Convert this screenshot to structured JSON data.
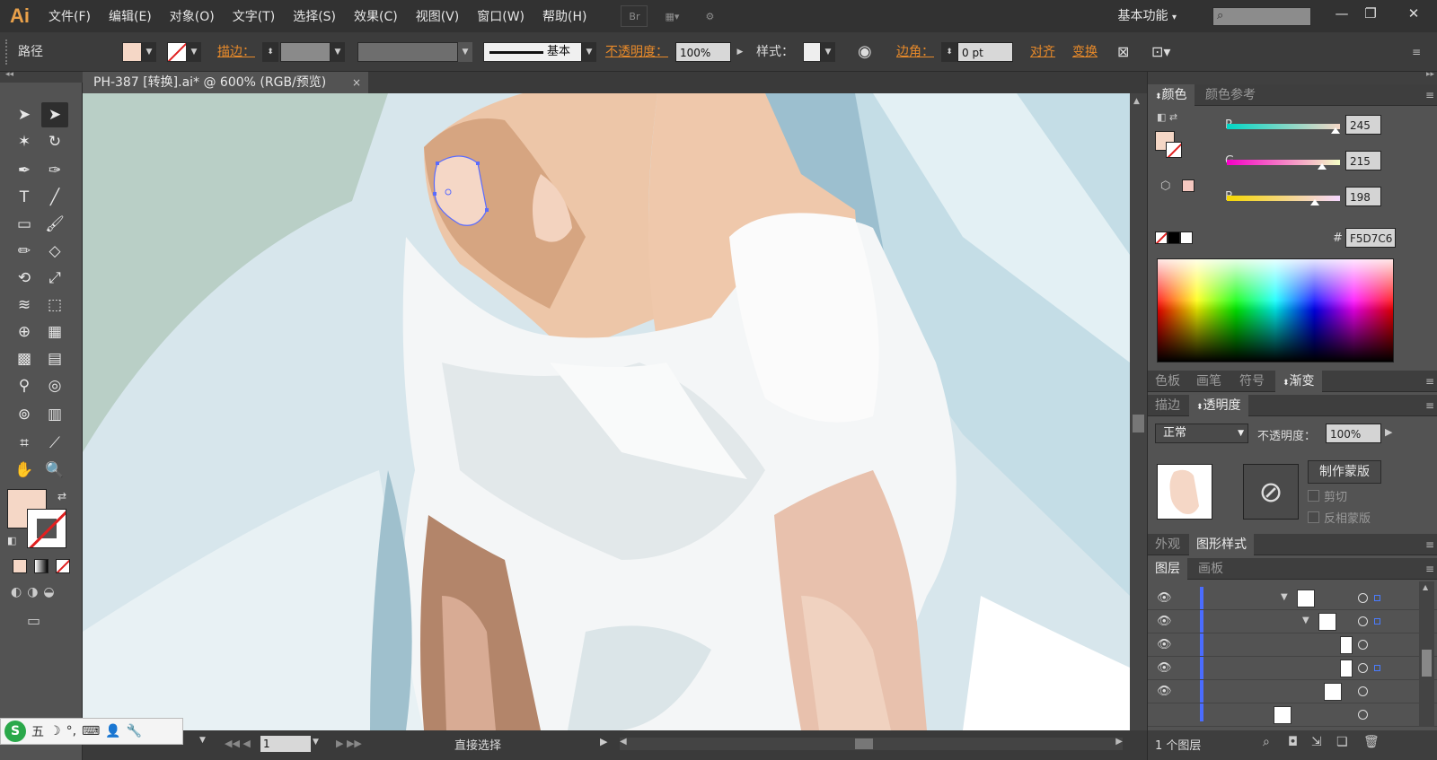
{
  "app": {
    "logo": "Ai"
  },
  "menu": [
    "文件(F)",
    "编辑(E)",
    "对象(O)",
    "文字(T)",
    "选择(S)",
    "效果(C)",
    "视图(V)",
    "窗口(W)",
    "帮助(H)"
  ],
  "menubar": {
    "bridge_label": "Br",
    "workspace": "基本功能",
    "workspace_arrow": "▾",
    "minimize": "—",
    "restore": "❐",
    "close": "✕"
  },
  "control_bar": {
    "object_type": "路径",
    "stroke_label": "描边：",
    "stroke_style": "基本",
    "opacity_label": "不透明度：",
    "opacity_value": "100%",
    "style_label": "样式：",
    "corner_label": "边角：",
    "corner_value": "0 pt",
    "align_label": "对齐",
    "transform_label": "变换",
    "fill_color": "#f5d7c6"
  },
  "document_tab": {
    "title": "PH-387 [转换].ai* @ 600% (RGB/预览)",
    "close": "×"
  },
  "status_bar": {
    "page": "1",
    "tool_name": "直接选择"
  },
  "ime": {
    "logo": "S",
    "items": [
      "五",
      "☽",
      "°,",
      "⌨",
      "👤",
      "🔧"
    ]
  },
  "color_panel": {
    "tabs": [
      "颜色",
      "颜色参考"
    ],
    "r": {
      "label": "R",
      "value": "245",
      "fraction": 0.96
    },
    "g": {
      "label": "G",
      "value": "215",
      "fraction": 0.84
    },
    "b": {
      "label": "B",
      "value": "198",
      "fraction": 0.78
    },
    "hex_label": "#",
    "hex": "F5D7C6"
  },
  "swatch_tabs": [
    "色板",
    "画笔",
    "符号",
    "渐变"
  ],
  "transparency_panel": {
    "tabs": [
      "描边",
      "透明度"
    ],
    "blend_mode": "正常",
    "opacity_label": "不透明度：",
    "opacity_value": "100%",
    "make_mask": "制作蒙版",
    "clip": "剪切",
    "invert_mask": "反相蒙版"
  },
  "appearance_tabs": [
    "外观",
    "图形样式"
  ],
  "layers_tabs": [
    "图层",
    "画板"
  ],
  "layers_footer": {
    "count": "1 个图层"
  },
  "colors": {
    "fill": "#f5d7c6",
    "accent_orange": "#e88a2a",
    "selection_blue": "#4a6cff"
  }
}
